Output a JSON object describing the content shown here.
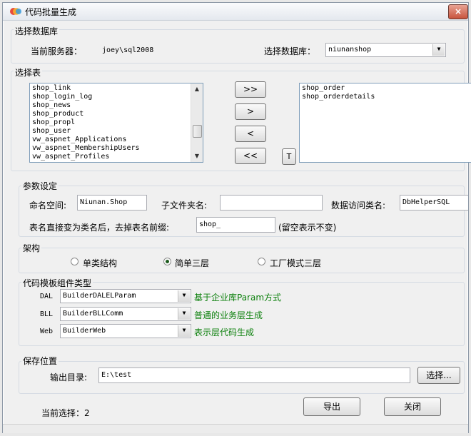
{
  "window": {
    "title": "代码批量生成",
    "close_label": "×"
  },
  "db_group": {
    "title": "选择数据库",
    "server_label": "当前服务器：",
    "server_value": "joey\\sql2008",
    "db_label": "选择数据库：",
    "db_value": "niunanshop"
  },
  "tables_group": {
    "title": "选择表",
    "available": [
      "shop_link",
      "shop_login_log",
      "shop_news",
      "shop_product",
      "shop_propl",
      "shop_user",
      "vw_aspnet_Applications",
      "vw_aspnet_MembershipUsers",
      "vw_aspnet_Profiles"
    ],
    "selected": [
      "shop_order",
      "shop_orderdetails"
    ],
    "buttons": {
      "add_all": ">>",
      "add": ">",
      "remove": "<",
      "remove_all": "<<",
      "t": "T"
    }
  },
  "params_group": {
    "title": "参数设定",
    "namespace_label": "命名空间:",
    "namespace_value": "Niunan.Shop",
    "subfolder_label": "子文件夹名:",
    "subfolder_value": "",
    "dal_class_label": "数据访问类名:",
    "dal_class_value": "DbHelperSQL",
    "prefix_label": "表名直接变为类名后，去掉表名前缀:",
    "prefix_value": "shop_",
    "prefix_hint": "(留空表示不变)"
  },
  "arch_group": {
    "title": "架构",
    "options": [
      "单类结构",
      "简单三层",
      "工厂模式三层"
    ],
    "selected_index": 1
  },
  "template_group": {
    "title": "代码模板组件类型",
    "rows": [
      {
        "label": "DAL",
        "value": "BuilderDALELParam",
        "desc": "基于企业库Param方式"
      },
      {
        "label": "BLL",
        "value": "BuilderBLLComm",
        "desc": "普通的业务层生成"
      },
      {
        "label": "Web",
        "value": "BuilderWeb",
        "desc": "表示层代码生成"
      }
    ]
  },
  "save_group": {
    "title": "保存位置",
    "output_label": "输出目录:",
    "output_value": "E:\\test",
    "browse_label": "选择..."
  },
  "footer": {
    "current_label": "当前选择：2",
    "export_label": "导出",
    "close_label": "关闭"
  },
  "colors": {
    "desc_text": "#0a7f0a",
    "close_button": "#c8543d"
  }
}
